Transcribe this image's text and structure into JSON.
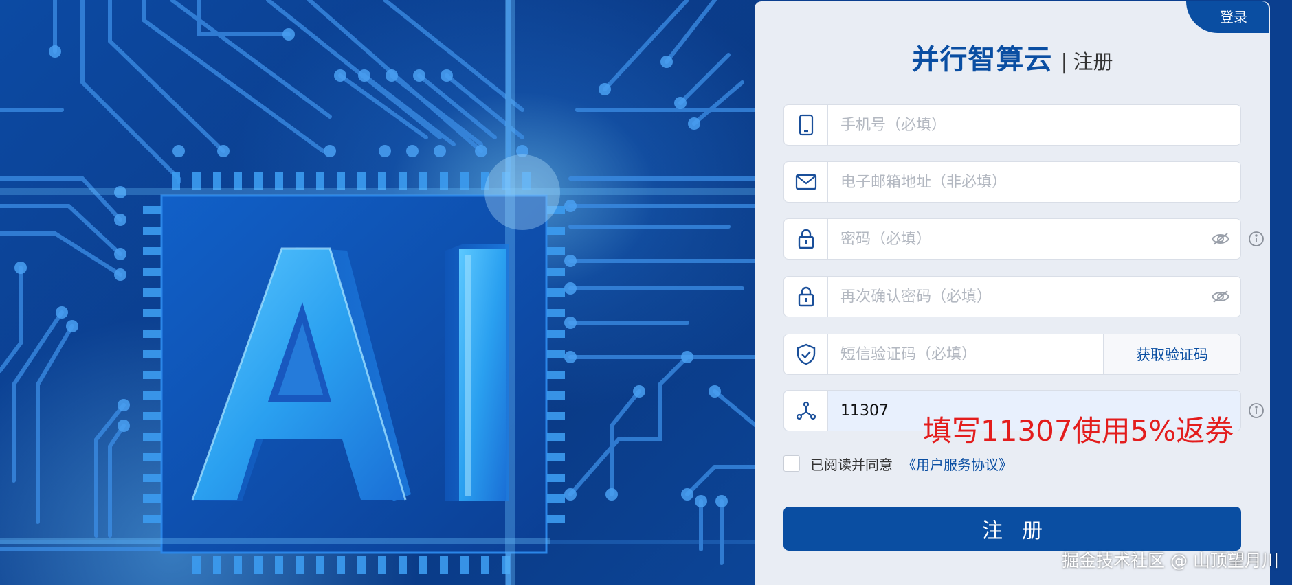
{
  "header": {
    "login_label": "登录",
    "brand": "并行智算云",
    "separator": "|",
    "subtitle": "注册"
  },
  "form": {
    "phone": {
      "placeholder": "手机号（必填）",
      "icon": "phone-icon"
    },
    "email": {
      "placeholder": "电子邮箱地址（非必填）",
      "icon": "mail-icon"
    },
    "password": {
      "placeholder": "密码（必填）",
      "icon": "lock-icon"
    },
    "confirm_password": {
      "placeholder": "再次确认密码（必填）",
      "icon": "lock-icon"
    },
    "sms_code": {
      "placeholder": "短信验证码（必填）",
      "icon": "shield-check-icon",
      "button_label": "获取验证码"
    },
    "invite_code": {
      "value": "11307",
      "icon": "network-icon"
    }
  },
  "promo_text": "填写11307使用5%返券",
  "agreement": {
    "text": "已阅读并同意",
    "link": "《用户服务协议》",
    "checked": false
  },
  "submit_label": "注册",
  "watermark": "掘金技术社区 @ 山顶望月川",
  "background": {
    "hero_letters": "AI"
  },
  "colors": {
    "brand_blue": "#0a4ea2",
    "panel_bg": "#e9edf4",
    "promo_red": "#e31d1d",
    "placeholder_gray": "#b3b8c1"
  }
}
